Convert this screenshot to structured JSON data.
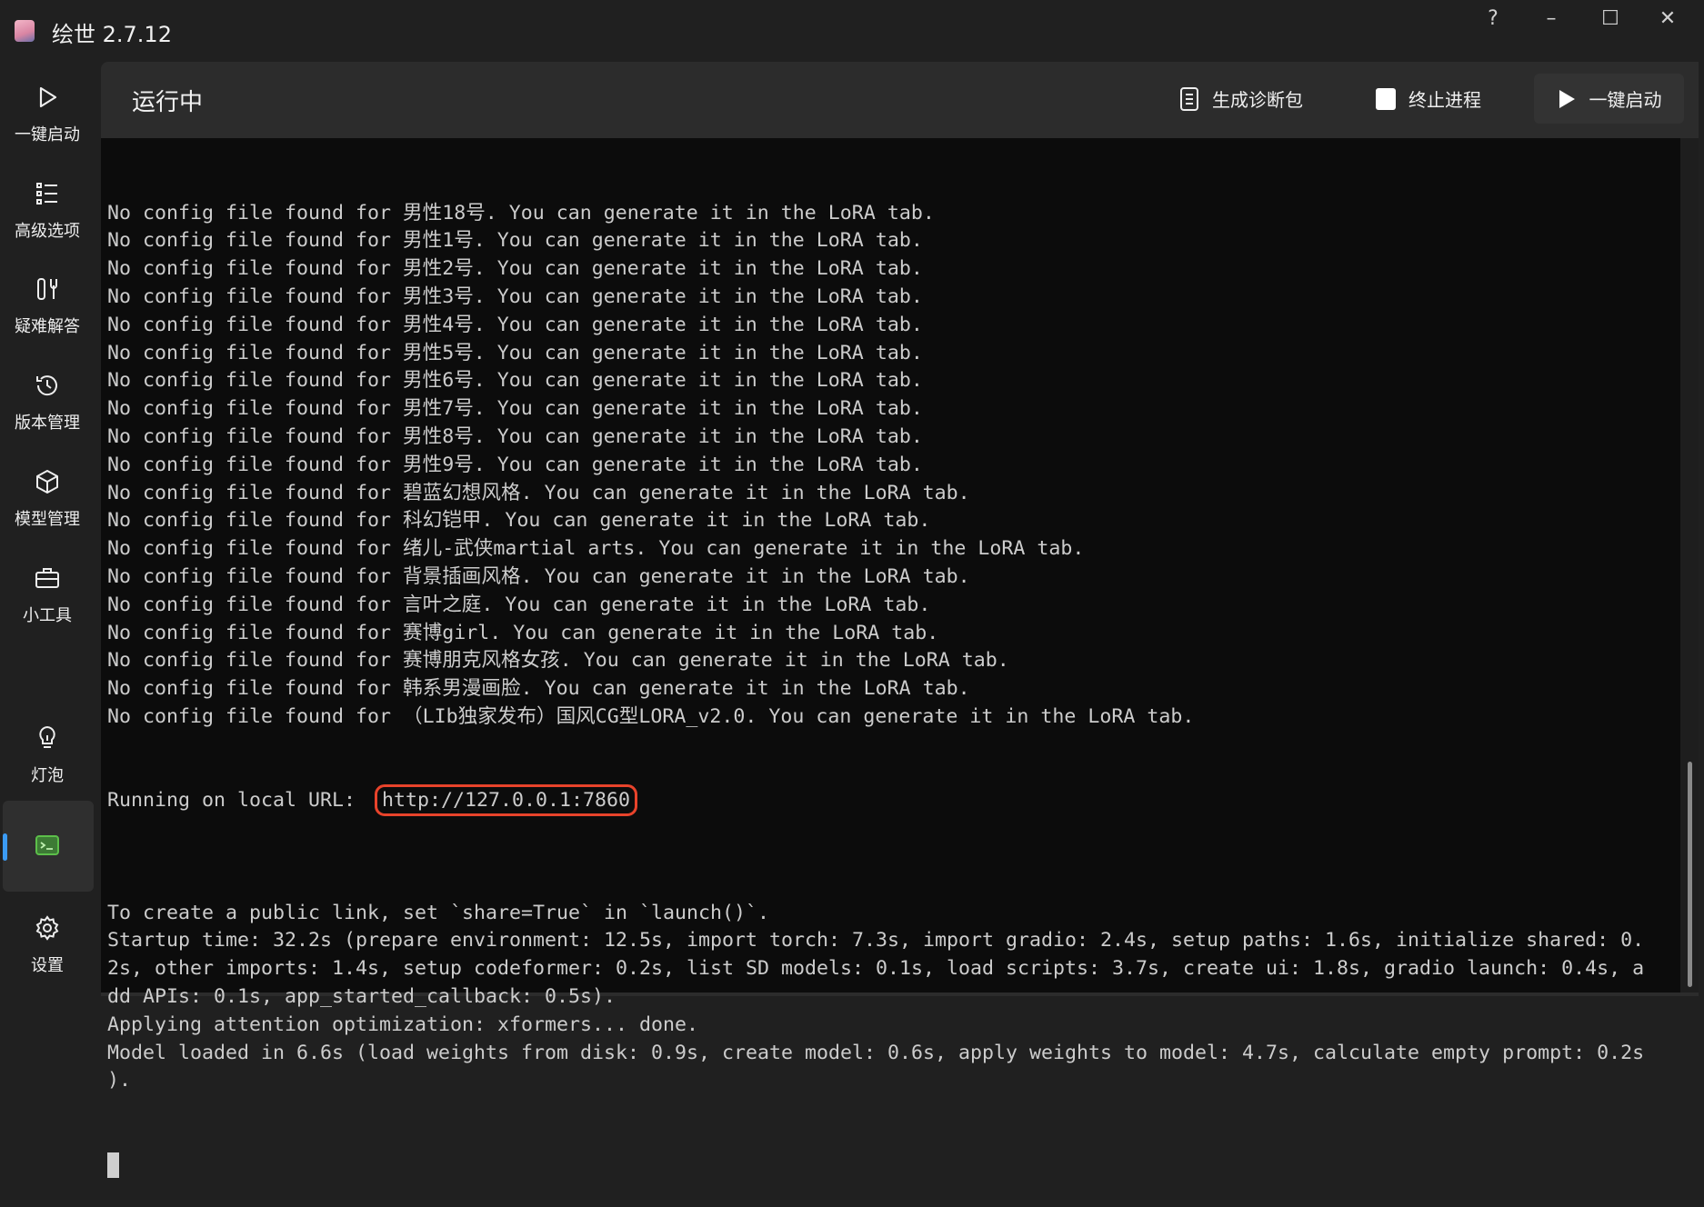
{
  "app": {
    "title": "绘世 2.7.12"
  },
  "window_controls": {
    "help": "?",
    "minimize": "–",
    "maximize": "☐",
    "close": "✕"
  },
  "sidebar": {
    "items": [
      {
        "label": "一键启动"
      },
      {
        "label": "高级选项"
      },
      {
        "label": "疑难解答"
      },
      {
        "label": "版本管理"
      },
      {
        "label": "模型管理"
      },
      {
        "label": "小工具"
      },
      {
        "label": "灯泡"
      },
      {
        "label": "设置"
      }
    ],
    "accent": "#3b9bf5",
    "terminal_icon_color": "#5cbf4a"
  },
  "header": {
    "title": "运行中",
    "diagnostic_label": "生成诊断包",
    "stop_label": "终止进程",
    "start_label": "一键启动"
  },
  "terminal": {
    "lines_before": [
      "No config file found for 男性18号. You can generate it in the LoRA tab.",
      "No config file found for 男性1号. You can generate it in the LoRA tab.",
      "No config file found for 男性2号. You can generate it in the LoRA tab.",
      "No config file found for 男性3号. You can generate it in the LoRA tab.",
      "No config file found for 男性4号. You can generate it in the LoRA tab.",
      "No config file found for 男性5号. You can generate it in the LoRA tab.",
      "No config file found for 男性6号. You can generate it in the LoRA tab.",
      "No config file found for 男性7号. You can generate it in the LoRA tab.",
      "No config file found for 男性8号. You can generate it in the LoRA tab.",
      "No config file found for 男性9号. You can generate it in the LoRA tab.",
      "No config file found for 碧蓝幻想风格. You can generate it in the LoRA tab.",
      "No config file found for 科幻铠甲. You can generate it in the LoRA tab.",
      "No config file found for 绪儿-武侠martial arts. You can generate it in the LoRA tab.",
      "No config file found for 背景插画风格. You can generate it in the LoRA tab.",
      "No config file found for 言叶之庭. You can generate it in the LoRA tab.",
      "No config file found for 赛博girl. You can generate it in the LoRA tab.",
      "No config file found for 赛博朋克风格女孩. You can generate it in the LoRA tab.",
      "No config file found for 韩系男漫画脸. You can generate it in the LoRA tab.",
      "No config file found for （LIb独家发布）国风CG型LORA_v2.0. You can generate it in the LoRA tab."
    ],
    "url_prefix": "Running on local URL:  ",
    "url": "http://127.0.0.1:7860",
    "lines_after": [
      "",
      "To create a public link, set `share=True` in `launch()`.",
      "Startup time: 32.2s (prepare environment: 12.5s, import torch: 7.3s, import gradio: 2.4s, setup paths: 1.6s, initialize shared: 0.",
      "2s, other imports: 1.4s, setup codeformer: 0.2s, list SD models: 0.1s, load scripts: 3.7s, create ui: 1.8s, gradio launch: 0.4s, a",
      "dd APIs: 0.1s, app_started_callback: 0.5s).",
      "Applying attention optimization: xformers... done.",
      "Model loaded in 6.6s (load weights from disk: 0.9s, create model: 0.6s, apply weights to model: 4.7s, calculate empty prompt: 0.2s",
      ")."
    ],
    "highlight_color": "#e8432b"
  }
}
